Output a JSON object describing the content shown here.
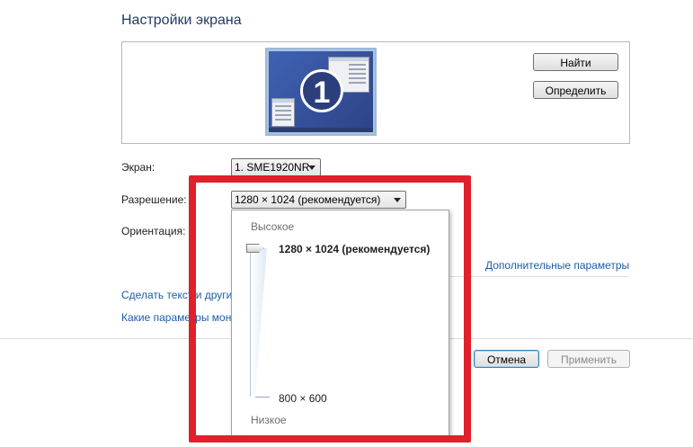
{
  "page": {
    "title": "Настройки экрана"
  },
  "buttons": {
    "find": "Найти",
    "identify": "Определить",
    "cancel": "Отмена",
    "apply": "Применить"
  },
  "display": {
    "monitor_number": "1",
    "screen_label": "Экран:",
    "screen_value": "1. SME1920NR",
    "resolution_label": "Разрешение:",
    "resolution_value": "1280 × 1024 (рекомендуется)",
    "orientation_label": "Ориентация:"
  },
  "links": {
    "advanced": "Дополнительные параметры",
    "text_size": "Сделать текст и другие",
    "which_params": "Какие параметры мон"
  },
  "resolution_dropdown": {
    "high_label": "Высокое",
    "low_label": "Низкое",
    "current": "1280 × 1024 (рекомендуется)",
    "minimum": "800 × 600",
    "slider_position": 1.0
  },
  "colors": {
    "highlight_border": "#e0202b",
    "link": "#1a5ea8",
    "title": "#1e3a5f"
  }
}
